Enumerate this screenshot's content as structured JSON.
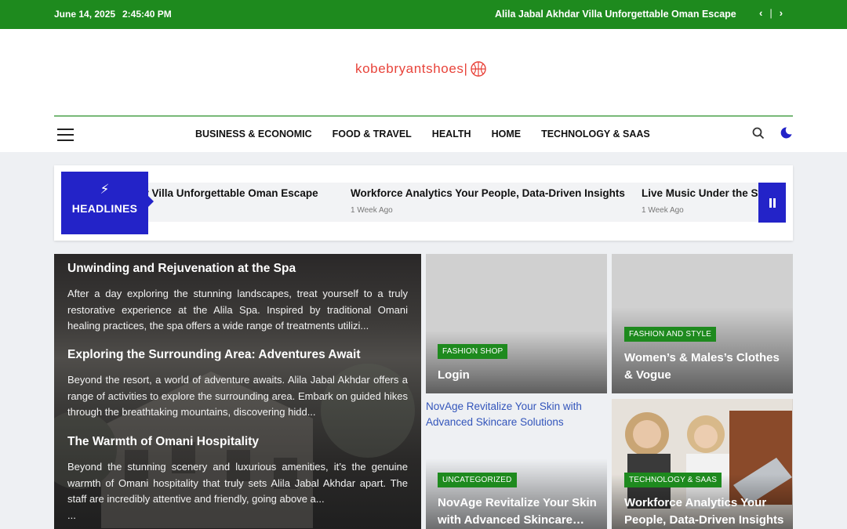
{
  "topbar": {
    "date": "June 14, 2025",
    "time": "2:45:40 PM",
    "ticker_title": "Alila Jabal Akhdar Villa Unforgettable Oman Escape",
    "prev_icon": "chevron-left-icon",
    "next_icon": "chevron-right-icon",
    "separator": "|"
  },
  "header": {
    "logo_text": "kobebryantshoes|",
    "logo_color": "#e8433a",
    "accent_color": "#1e8a1e",
    "nav": [
      "BUSINESS & ECONOMIC",
      "FOOD & TRAVEL",
      "HEALTH",
      "HOME",
      "TECHNOLOGY & SAAS"
    ]
  },
  "headlines": {
    "label": "HEADLINES",
    "badge_color": "#2323c8",
    "items": [
      {
        "title": "Alila Jabal Akhdar Villa Unforgettable Oman Escape",
        "visible_title": "ar Villa Unforgettable Oman Escape",
        "age": ""
      },
      {
        "title": "Workforce Analytics Your People, Data-Driven Insights",
        "visible_title": "Workforce Analytics Your People, Data-Driven Insights",
        "age": "1 Week Ago"
      },
      {
        "title": "Live Music Under the Stars",
        "visible_title": "Live Music Under the Sta",
        "age": "1 Week Ago"
      }
    ]
  },
  "feature": {
    "sections": [
      {
        "heading": "Unwinding and Rejuvenation at the Spa",
        "text": "After a day exploring the stunning landscapes, treat yourself to a truly restorative experience at the Alila Spa. Inspired by traditional Omani healing practices, the spa offers a wide range of treatments utilizi..."
      },
      {
        "heading": "Exploring the Surrounding Area: Adventures Await",
        "text": "Beyond the resort, a world of adventure awaits. Alila Jabal Akhdar offers a range of activities to explore the surrounding area. Embark on guided hikes through the breathtaking mountains, discovering hidd..."
      },
      {
        "heading": "The Warmth of Omani Hospitality",
        "text": "Beyond the stunning scenery and luxurious amenities, it’s the genuine warmth of Omani hospitality that truly sets Alila Jabal Akhdar apart. The staff are incredibly attentive and friendly, going above a..."
      }
    ],
    "ellipsis": "..."
  },
  "cards": [
    {
      "category": "FASHION SHOP",
      "title": "Login"
    },
    {
      "category": "FASHION AND STYLE",
      "title": "Women’s & Males’s Clothes & Vogue"
    },
    {
      "category": "UNCATEGORIZED",
      "title": "NovAge Revitalize Your Skin with Advanced Skincare…",
      "alt": "NovAge Revitalize Your Skin with Advanced Skincare Solutions"
    },
    {
      "category": "TECHNOLOGY & SAAS",
      "title": "Workforce Analytics Your People, Data-Driven Insights"
    }
  ]
}
